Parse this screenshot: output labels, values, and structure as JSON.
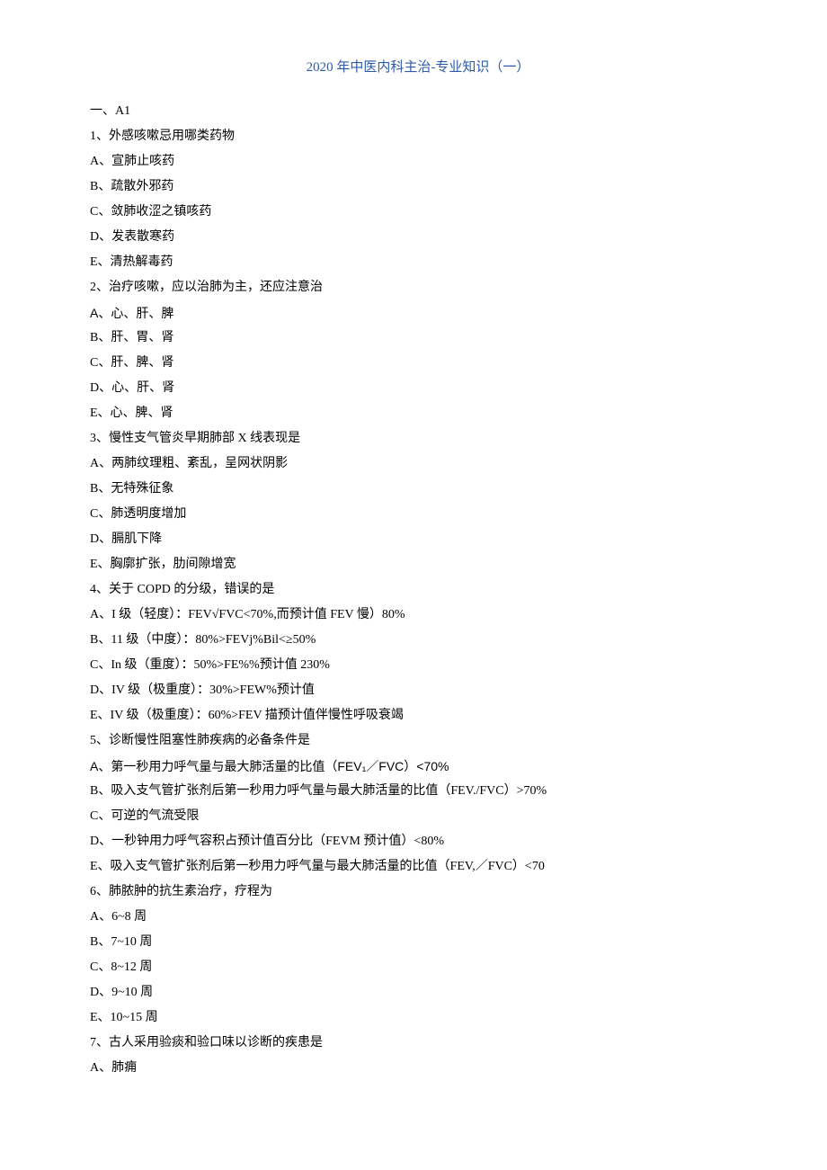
{
  "title": "2020 年中医内科主治-专业知识（一）",
  "lines": [
    {
      "text": "一、A1",
      "sans": false
    },
    {
      "text": "1、外感咳嗽忌用哪类药物",
      "sans": false
    },
    {
      "text": "A、宣肺止咳药",
      "sans": false
    },
    {
      "text": "B、疏散外邪药",
      "sans": false
    },
    {
      "text": "C、敛肺收涩之镇咳药",
      "sans": false
    },
    {
      "text": "D、发表散寒药",
      "sans": false
    },
    {
      "text": "E、清热解毒药",
      "sans": false
    },
    {
      "text": "2、治疗咳嗽，应以治肺为主，还应注意治",
      "sans": false
    },
    {
      "text": "A、心、肝、脾",
      "sans": true
    },
    {
      "text": "B、肝、胃、肾",
      "sans": false
    },
    {
      "text": "C、肝、脾、肾",
      "sans": false
    },
    {
      "text": "D、心、肝、肾",
      "sans": false
    },
    {
      "text": "E、心、脾、肾",
      "sans": false
    },
    {
      "text": "3、慢性支气管炎早期肺部 X 线表现是",
      "sans": false
    },
    {
      "text": "A、两肺纹理粗、紊乱，呈网状阴影",
      "sans": false
    },
    {
      "text": "B、无特殊征象",
      "sans": false
    },
    {
      "text": "C、肺透明度增加",
      "sans": false
    },
    {
      "text": "D、膈肌下降",
      "sans": false
    },
    {
      "text": "E、胸廓扩张，肋间隙增宽",
      "sans": false
    },
    {
      "text": "4、关于 COPD 的分级，错误的是",
      "sans": false
    },
    {
      "text": "A、I 级（轻度）：FEV√FVC<70%,而预计值 FEV 慢）80%",
      "sans": false
    },
    {
      "text": "B、11 级（中度）：80%>FEVj%Bil<≥50%",
      "sans": false
    },
    {
      "text": "C、In 级（重度）：50%>FE%%预计值 230%",
      "sans": false
    },
    {
      "text": "D、IV 级（极重度）：30%>FEW%预计值",
      "sans": false
    },
    {
      "text": "E、IV 级（极重度）：60%>FEV 描预计值伴慢性呼吸衰竭",
      "sans": false
    },
    {
      "text": "5、诊断慢性阻塞性肺疾病的必备条件是",
      "sans": false
    },
    {
      "text": "A、第一秒用力呼气量与最大肺活量的比值（FEV₁／FVC）<70%",
      "sans": true
    },
    {
      "text": "B、吸入支气管扩张剂后第一秒用力呼气量与最大肺活量的比值（FEV./FVC）>70%",
      "sans": false
    },
    {
      "text": "C、可逆的气流受限",
      "sans": false
    },
    {
      "text": "D、一秒钟用力呼气容积占预计值百分比（FEVM 预计值）<80%",
      "sans": false
    },
    {
      "text": "E、吸入支气管扩张剂后第一秒用力呼气量与最大肺活量的比值（FEV,／FVC）<70",
      "sans": false
    },
    {
      "text": "6、肺脓肿的抗生素治疗，疗程为",
      "sans": false
    },
    {
      "text": "A、6~8 周",
      "sans": false
    },
    {
      "text": "B、7~10 周",
      "sans": false
    },
    {
      "text": "C、8~12 周",
      "sans": false
    },
    {
      "text": "D、9~10 周",
      "sans": false
    },
    {
      "text": "E、10~15 周",
      "sans": false
    },
    {
      "text": "7、古人采用验痰和验口味以诊断的疾患是",
      "sans": false
    },
    {
      "text": "A、肺痈",
      "sans": false
    }
  ]
}
